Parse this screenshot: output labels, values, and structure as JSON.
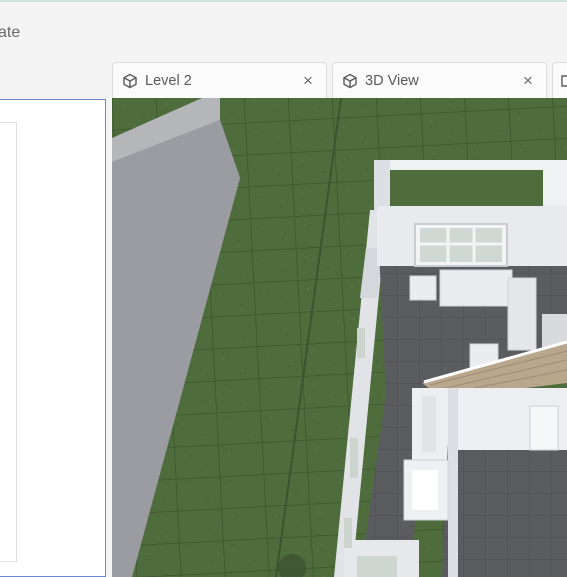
{
  "header": {
    "partial_label": "ate"
  },
  "tabs": [
    {
      "label": "Level 2",
      "close_glyph": "×",
      "icon": "cube-icon"
    },
    {
      "label": "3D View",
      "close_glyph": "×",
      "icon": "cube-icon"
    },
    {
      "label": "",
      "icon": "cube-icon"
    }
  ],
  "colors": {
    "lawn": "#4c6a3a",
    "wall": "#e8e9ec",
    "floor_dark": "#5a5b5e",
    "accent_border": "#6b87c9"
  }
}
